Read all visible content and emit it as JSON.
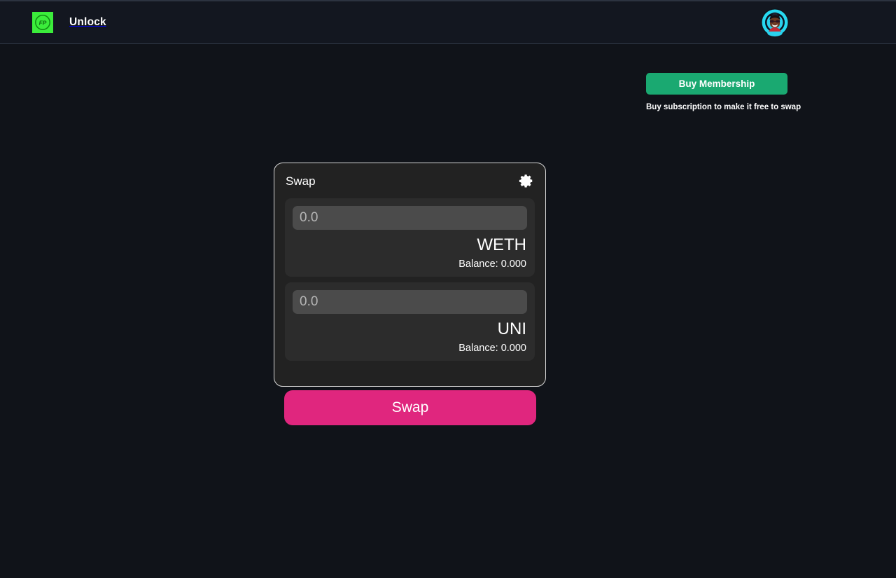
{
  "header": {
    "brand_name": "Unlock",
    "logo_icon": "fp-logo-icon",
    "logo_text": "FP",
    "avatar_icon": "user-avatar-icon"
  },
  "membership": {
    "buy_label": "Buy Membership",
    "note": "Buy subscription to make it free to swap",
    "accent_color": "#1aa971"
  },
  "swap_card": {
    "title": "Swap",
    "settings_icon": "gear-icon",
    "border_color": "#d8d8d8",
    "fields": [
      {
        "amount_value": "",
        "amount_placeholder": "0.0",
        "token_symbol": "WETH",
        "balance_label": "Balance: 0.000"
      },
      {
        "amount_value": "",
        "amount_placeholder": "0.0",
        "token_symbol": "UNI",
        "balance_label": "Balance: 0.000"
      }
    ]
  },
  "swap_action": {
    "label": "Swap",
    "color": "#e0267e"
  }
}
